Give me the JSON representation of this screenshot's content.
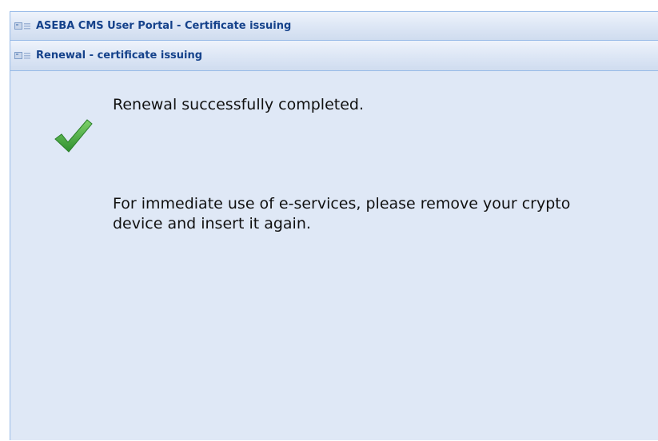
{
  "window": {
    "title": "ASEBA CMS User Portal - Certificate issuing",
    "icon": "panel-icon"
  },
  "panel": {
    "title": "Renewal - certificate issuing",
    "icon": "panel-icon"
  },
  "content": {
    "status_icon": "check-icon",
    "status_color": "#3aa23a",
    "success_message": "Renewal successfully completed.",
    "info_line_1": "For immediate use of e-services, please remove your crypto",
    "info_line_2": "device and insert it again."
  },
  "colors": {
    "background": "#dfe8f6",
    "border": "#99bbe8",
    "title_text": "#15428b"
  }
}
